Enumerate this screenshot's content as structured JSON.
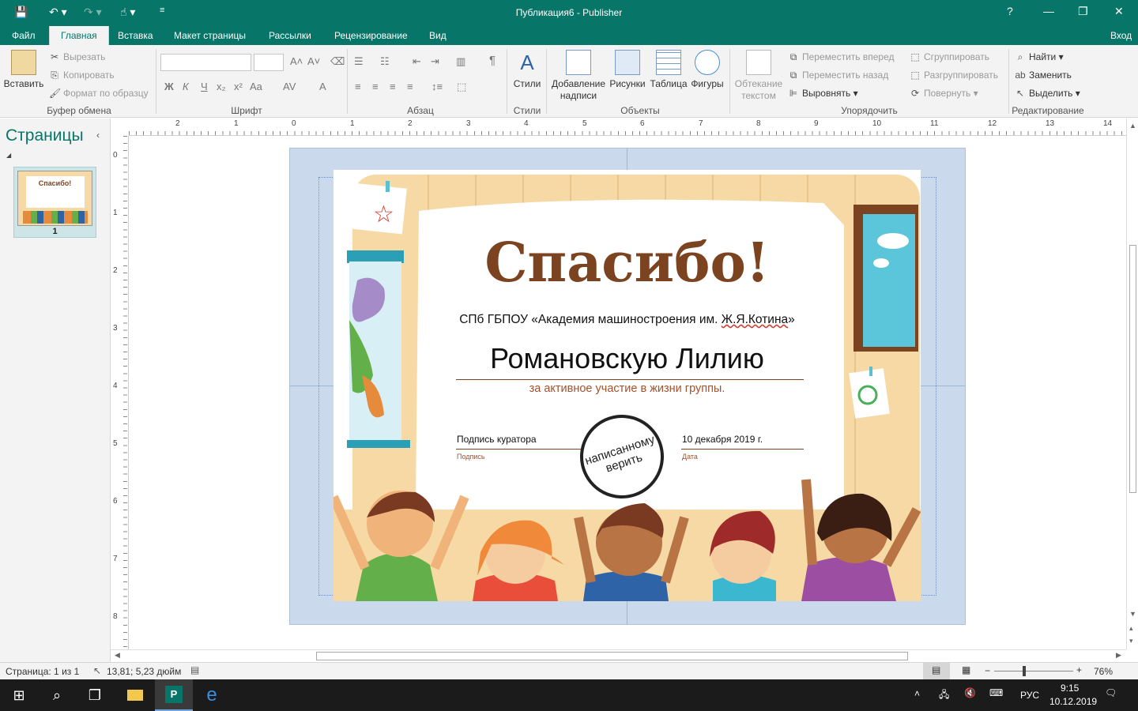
{
  "titlebar": {
    "title": "Публикация6 - Publisher",
    "help": "?",
    "minimize": "—",
    "restore": "❐",
    "close": "✕"
  },
  "tabs": [
    {
      "label": "Файл"
    },
    {
      "label": "Главная"
    },
    {
      "label": "Вставка"
    },
    {
      "label": "Макет страницы"
    },
    {
      "label": "Рассылки"
    },
    {
      "label": "Рецензирование"
    },
    {
      "label": "Вид"
    }
  ],
  "signin": "Вход",
  "ribbon": {
    "clipboard": {
      "paste": "Вставить",
      "cut": "Вырезать",
      "copy": "Копировать",
      "format_painter": "Формат по образцу",
      "group": "Буфер обмена"
    },
    "font": {
      "group": "Шрифт",
      "bold": "Ж",
      "italic": "К",
      "underline": "Ч",
      "subscript": "x₂",
      "superscript": "x²",
      "case": "Aa",
      "spacing": "AV",
      "color": "A"
    },
    "paragraph": {
      "group": "Абзац",
      "pilcrow": "¶"
    },
    "styles": {
      "label": "Стили",
      "group": "Стили"
    },
    "objects": {
      "textbox": "Добавление надписи",
      "pictures": "Рисунки",
      "table": "Таблица",
      "shapes": "Фигуры",
      "group": "Объекты"
    },
    "arrange": {
      "wrap": "Обтекание текстом",
      "forward": "Переместить вперед",
      "backward": "Переместить назад",
      "align": "Выровнять",
      "group_btn": "Сгруппировать",
      "ungroup": "Разгруппировать",
      "rotate": "Повернуть",
      "group": "Упорядочить"
    },
    "editing": {
      "find": "Найти",
      "replace": "Заменить",
      "select": "Выделить",
      "group": "Редактирование"
    }
  },
  "pages_pane": {
    "title": "Страницы",
    "thumb_number": "1",
    "thumb_title": "Спасибо!"
  },
  "ruler": {
    "h": [
      "2",
      "1",
      "0",
      "1",
      "2",
      "3",
      "4",
      "5",
      "6",
      "7",
      "8",
      "9",
      "10",
      "11",
      "12",
      "13",
      "14"
    ],
    "v": [
      "0",
      "1",
      "2",
      "3",
      "4",
      "5",
      "6",
      "7",
      "8"
    ]
  },
  "certificate": {
    "title": "Спасибо!",
    "org_prefix": "СПб ГБПОУ «Академия машиностроения им. ",
    "org_name": "Ж.Я.Котина",
    "org_suffix": "»",
    "recipient": "Романовскую Лилию",
    "reason": "за активное участие в жизни группы.",
    "sign_value": "Подпись  куратора",
    "sign_label": "Подпись",
    "date_value": "10  декабря 2019 г.",
    "date_label": "Дата",
    "stamp_line1": "написанному",
    "stamp_line2": "верить"
  },
  "status": {
    "page": "Страница: 1 из 1",
    "position": "13,81; 5,23 дюйм",
    "zoom": "76%",
    "minus": "−",
    "plus": "+"
  },
  "taskbar": {
    "lang": "РУС",
    "time": "9:15",
    "date": "10.12.2019"
  },
  "colors": {
    "accent": "#077568",
    "title_brown": "#7b4320",
    "frame": "#f7d9a5"
  }
}
